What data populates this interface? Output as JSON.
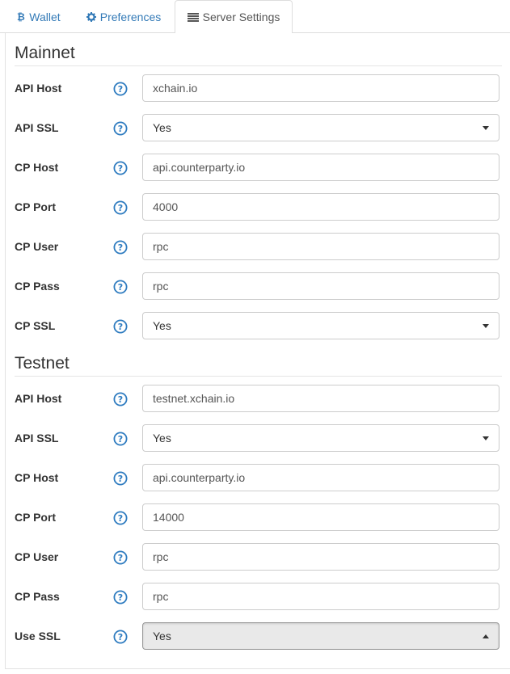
{
  "tabs": [
    {
      "label": "Wallet",
      "icon": "bitcoin-icon",
      "active": false
    },
    {
      "label": "Preferences",
      "icon": "gear-icon",
      "active": false
    },
    {
      "label": "Server Settings",
      "icon": "list-icon",
      "active": true
    }
  ],
  "colors": {
    "link": "#337ab7",
    "help_icon": "#2f7cc0"
  },
  "mainnet": {
    "title": "Mainnet",
    "rows": [
      {
        "label": "API Host",
        "type": "input",
        "value": "xchain.io"
      },
      {
        "label": "API SSL",
        "type": "select",
        "value": "Yes"
      },
      {
        "label": "CP Host",
        "type": "input",
        "value": "api.counterparty.io"
      },
      {
        "label": "CP Port",
        "type": "input",
        "value": "4000"
      },
      {
        "label": "CP User",
        "type": "input",
        "value": "rpc"
      },
      {
        "label": "CP Pass",
        "type": "input",
        "value": "rpc"
      },
      {
        "label": "CP SSL",
        "type": "select",
        "value": "Yes"
      }
    ]
  },
  "testnet": {
    "title": "Testnet",
    "rows": [
      {
        "label": "API Host",
        "type": "input",
        "value": "testnet.xchain.io"
      },
      {
        "label": "API SSL",
        "type": "select",
        "value": "Yes"
      },
      {
        "label": "CP Host",
        "type": "input",
        "value": "api.counterparty.io"
      },
      {
        "label": "CP Port",
        "type": "input",
        "value": "14000"
      },
      {
        "label": "CP User",
        "type": "input",
        "value": "rpc"
      },
      {
        "label": "CP Pass",
        "type": "input",
        "value": "rpc"
      },
      {
        "label": "Use SSL",
        "type": "select",
        "value": "Yes",
        "open": true
      }
    ]
  }
}
